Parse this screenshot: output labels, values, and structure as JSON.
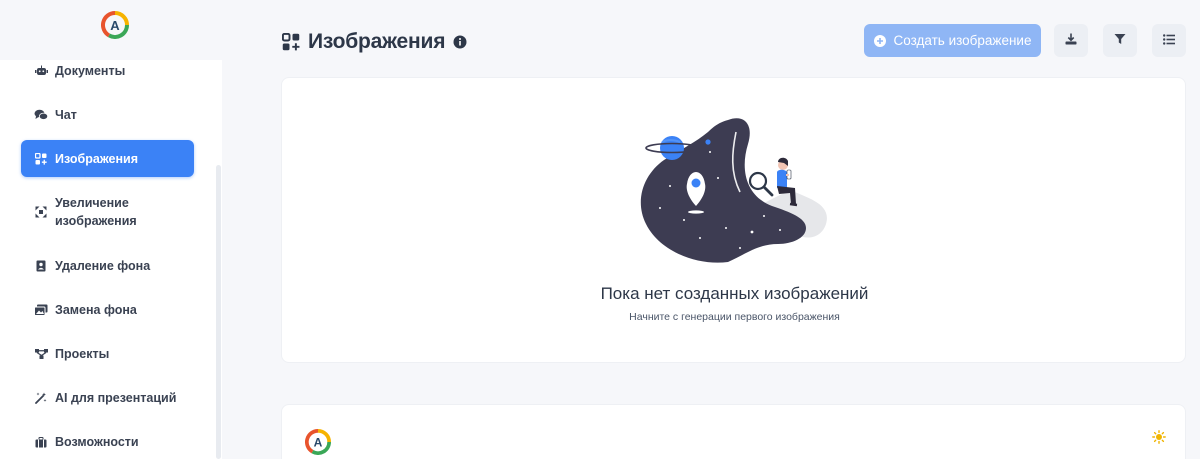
{
  "colors": {
    "accent": "#3b82f6",
    "accent_light": "#8fb6f5",
    "background": "#f6f7fa",
    "illustration_dark": "#3d3c52"
  },
  "sidebar": {
    "logo_letter": "A",
    "items": [
      {
        "label": "Документы",
        "icon": "robot-icon",
        "active": false
      },
      {
        "label": "Чат",
        "icon": "chat-bubbles-icon",
        "active": false
      },
      {
        "label": "Изображения",
        "icon": "image-grid-icon",
        "active": true
      },
      {
        "label": "Увеличение\nизображения",
        "icon": "expand-icon",
        "active": false
      },
      {
        "label": "Удаление фона",
        "icon": "portrait-icon",
        "active": false
      },
      {
        "label": "Замена фона",
        "icon": "images-icon",
        "active": false
      },
      {
        "label": "Проекты",
        "icon": "diagram-icon",
        "active": false
      },
      {
        "label": "AI для презентаций",
        "icon": "magic-wand-icon",
        "active": false
      },
      {
        "label": "Возможности",
        "icon": "briefcase-icon",
        "active": false
      }
    ]
  },
  "header": {
    "title": "Изображения",
    "create_button_label": "Создать изображение",
    "tool_icons": [
      "download-icon",
      "filter-icon",
      "list-icon"
    ]
  },
  "empty_state": {
    "title": "Пока нет созданных изображений",
    "subtitle": "Начните с генерации первого изображения",
    "illustration": "space-person-search-illustration"
  },
  "footer": {
    "logo_letter": "A",
    "theme_icon": "sun-icon"
  }
}
